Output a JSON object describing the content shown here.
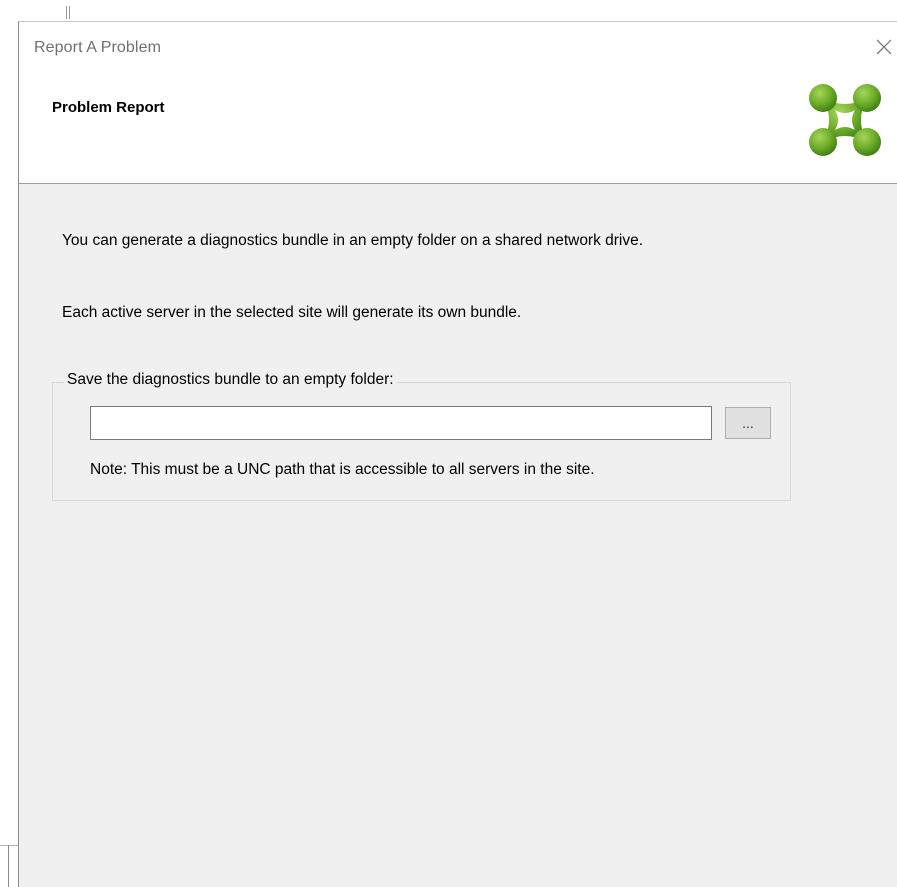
{
  "window": {
    "title": "Report A Problem",
    "close_glyph": "✕"
  },
  "header": {
    "title": "Problem Report",
    "logo_icon": "citrix-logo-icon",
    "logo_colors": [
      "#8dc63f",
      "#5a9e1f",
      "#3f7f12"
    ]
  },
  "content": {
    "line1": "You can generate a diagnostics bundle in an empty folder on a shared network drive.",
    "line2": "Each active server in the selected site will generate its own bundle."
  },
  "save_group": {
    "legend": "Save the diagnostics bundle to an empty folder:",
    "path_value": "",
    "browse_label": "...",
    "note": "Note: This must be a UNC path that is accessible to all servers in the site."
  }
}
